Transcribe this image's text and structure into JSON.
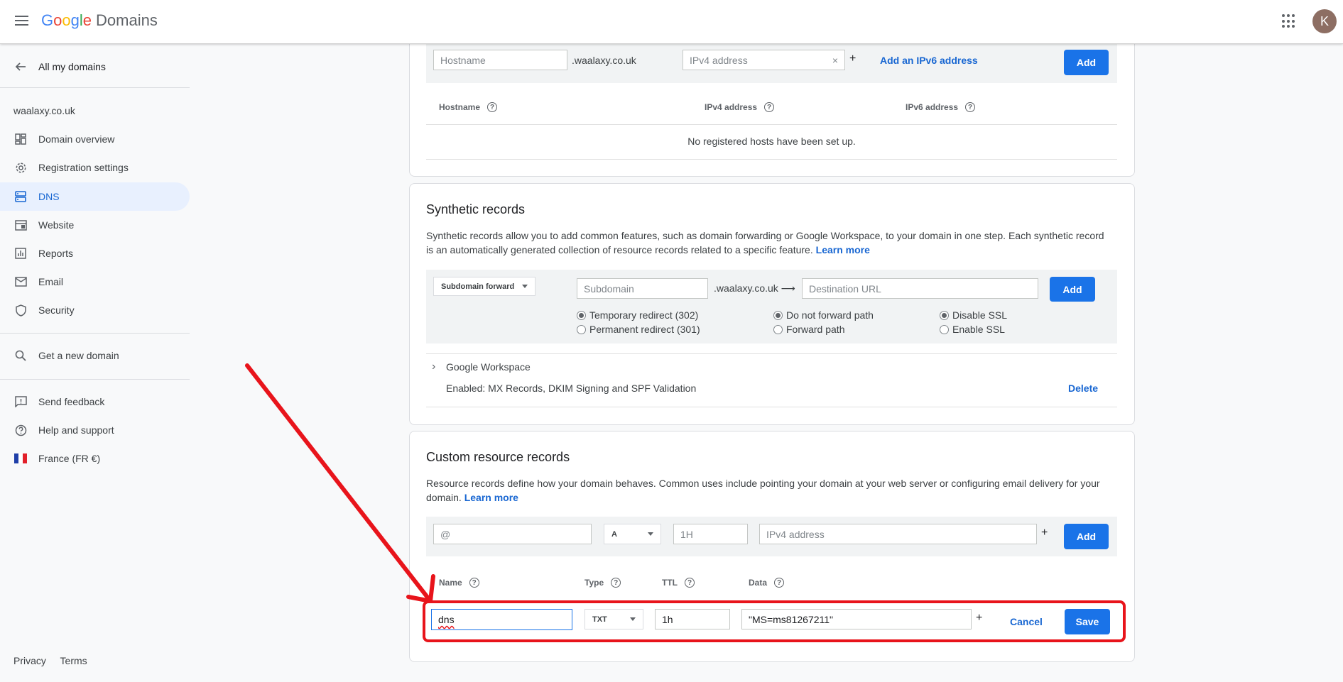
{
  "header": {
    "logo_letters": [
      "G",
      "o",
      "o",
      "g",
      "l",
      "e"
    ],
    "product": "Domains",
    "avatar_initial": "K"
  },
  "sidebar": {
    "back_label": "All my domains",
    "domain": "waalaxy.co.uk",
    "items": [
      {
        "label": "Domain overview",
        "icon": "dashboard-icon"
      },
      {
        "label": "Registration settings",
        "icon": "gear-icon"
      },
      {
        "label": "DNS",
        "icon": "dns-icon",
        "active": true
      },
      {
        "label": "Website",
        "icon": "website-icon"
      },
      {
        "label": "Reports",
        "icon": "chart-icon"
      },
      {
        "label": "Email",
        "icon": "mail-icon"
      },
      {
        "label": "Security",
        "icon": "shield-icon"
      }
    ],
    "get_domain": "Get a new domain",
    "support": [
      {
        "label": "Send feedback",
        "icon": "feedback-icon"
      },
      {
        "label": "Help and support",
        "icon": "help-icon"
      },
      {
        "label": "France (FR €)",
        "icon": "france-flag-icon"
      }
    ],
    "footer": {
      "privacy": "Privacy",
      "terms": "Terms"
    }
  },
  "hosts": {
    "hostname_placeholder": "Hostname",
    "domain_suffix": ".waalaxy.co.uk",
    "ipv4_placeholder": "IPv4 address",
    "plus": "+",
    "add_ipv6": "Add an IPv6 address",
    "add_button": "Add",
    "columns": [
      "Hostname",
      "IPv4 address",
      "IPv6 address"
    ],
    "empty_message": "No registered hosts have been set up."
  },
  "synthetic": {
    "title": "Synthetic records",
    "description": "Synthetic records allow you to add common features, such as domain forwarding or Google Workspace, to your domain in one step. Each synthetic record is an automatically generated collection of resource records related to a specific feature.",
    "learn_more": "Learn more",
    "type_select": "Subdomain forward",
    "subdomain_placeholder": "Subdomain",
    "domain_arrow": ".waalaxy.co.uk ⟶",
    "destination_placeholder": "Destination URL",
    "add_button": "Add",
    "radios": {
      "temp": "Temporary redirect (302)",
      "perm": "Permanent redirect (301)",
      "no_forward": "Do not forward path",
      "forward": "Forward path",
      "disable_ssl": "Disable SSL",
      "enable_ssl": "Enable SSL"
    },
    "workspace": {
      "name": "Google Workspace",
      "status": "Enabled: MX Records, DKIM Signing and SPF Validation",
      "delete": "Delete"
    }
  },
  "custom": {
    "title": "Custom resource records",
    "description": "Resource records define how your domain behaves. Common uses include pointing your domain at your web server or configuring email delivery for your domain.",
    "learn_more": "Learn more",
    "new_row": {
      "name_placeholder": "@",
      "type": "A",
      "ttl_placeholder": "1H",
      "data_placeholder": "IPv4 address",
      "plus": "+",
      "add": "Add"
    },
    "columns": [
      "Name",
      "Type",
      "TTL",
      "Data"
    ],
    "edit_row": {
      "name": "dns",
      "type": "TXT",
      "ttl": "1h",
      "data": "\"MS=ms81267211\"",
      "plus": "+",
      "cancel": "Cancel",
      "save": "Save"
    }
  },
  "colors": {
    "accent": "#1a73e8",
    "annotation": "#e8141b",
    "active_nav_bg": "#e8f0fe"
  }
}
